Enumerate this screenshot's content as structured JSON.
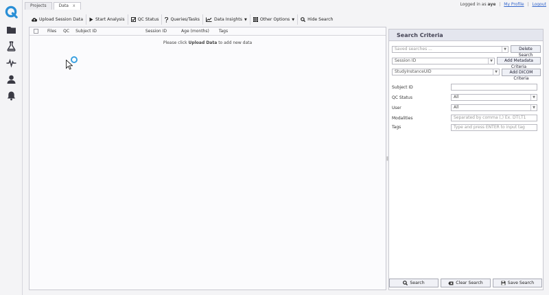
{
  "app": {
    "accent": "#2a8fd6"
  },
  "tabs": [
    {
      "label": "Projects"
    },
    {
      "label": "Data",
      "close": "x"
    }
  ],
  "user": {
    "prefix": "Logged in as",
    "name": "aye",
    "profile": "My Profile",
    "logout": "Logout",
    "sep": "|"
  },
  "toolbar": {
    "upload": "Upload Session Data",
    "start": "Start Analysis",
    "qc": "QC Status",
    "queries": "Queries/Tasks",
    "insights": "Data Insights",
    "other": "Other Options",
    "hide": "Hide Search"
  },
  "grid": {
    "columns": [
      "Files",
      "QC",
      "Subject ID",
      "Session ID",
      "Age (months)",
      "Tags"
    ],
    "empty_pre": "Please click",
    "empty_bold": "Upload Data",
    "empty_post": "to add new data"
  },
  "criteria": {
    "title": "Search Criteria",
    "saved_placeholder": "Saved searches ...",
    "delete_search": "Delete Search",
    "metadata_select": "Session ID",
    "add_metadata": "Add Metadata Criteria",
    "dicom_select": "StudyInstanceUID",
    "add_dicom": "Add DICOM Criteria",
    "fields": {
      "subject_label": "Subject ID",
      "qc_label": "QC Status",
      "qc_value": "All",
      "user_label": "User",
      "user_value": "All",
      "modalities_label": "Modalities",
      "modalities_placeholder": "Separated by comma (,) Ex. DTI,T1",
      "tags_label": "Tags",
      "tags_placeholder": "Type and press ENTER to input tag"
    },
    "search": "Search",
    "clear": "Clear Search",
    "save": "Save Search"
  }
}
